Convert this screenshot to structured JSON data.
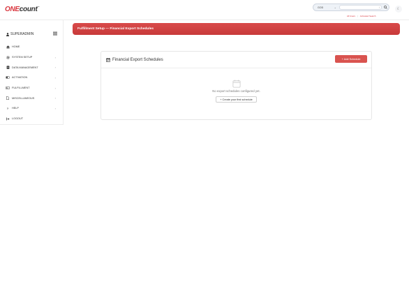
{
  "header": {
    "logo_one": "ONE",
    "logo_count": "count",
    "logo_tm": "™",
    "search": {
      "mode": "GOD",
      "shortcut": "/"
    },
    "links": {
      "all_users": "All Users",
      "activated_search": "Activated Search"
    }
  },
  "sidebar": {
    "user": "SUPERADMIN",
    "items": [
      {
        "label": "HOME",
        "icon": "home-icon",
        "has_arrow": false
      },
      {
        "label": "SYSTEM SETUP",
        "icon": "gear-icon",
        "has_arrow": true
      },
      {
        "label": "DATA MANAGEMENT",
        "icon": "database-icon",
        "has_arrow": true
      },
      {
        "label": "ACTIVATION",
        "icon": "toggle-icon",
        "has_arrow": true
      },
      {
        "label": "FULFILLMENT",
        "icon": "truck-icon",
        "has_arrow": true
      },
      {
        "label": "MISCELLANEOUS",
        "icon": "file-icon",
        "has_arrow": true
      },
      {
        "label": "HELP",
        "icon": "question-icon",
        "has_arrow": true
      },
      {
        "label": "LOGOUT",
        "icon": "logout-icon",
        "has_arrow": false
      }
    ]
  },
  "page": {
    "title": "Fulfillment Setup — Financial Export Schedules"
  },
  "card": {
    "title": "Financial Export Schedules",
    "add_label": "Add Schedule",
    "empty_text": "No export schedules configured yet.",
    "create_label": "Create your first schedule"
  },
  "colors": {
    "accent": "#d9363e",
    "button": "#d9534f"
  }
}
